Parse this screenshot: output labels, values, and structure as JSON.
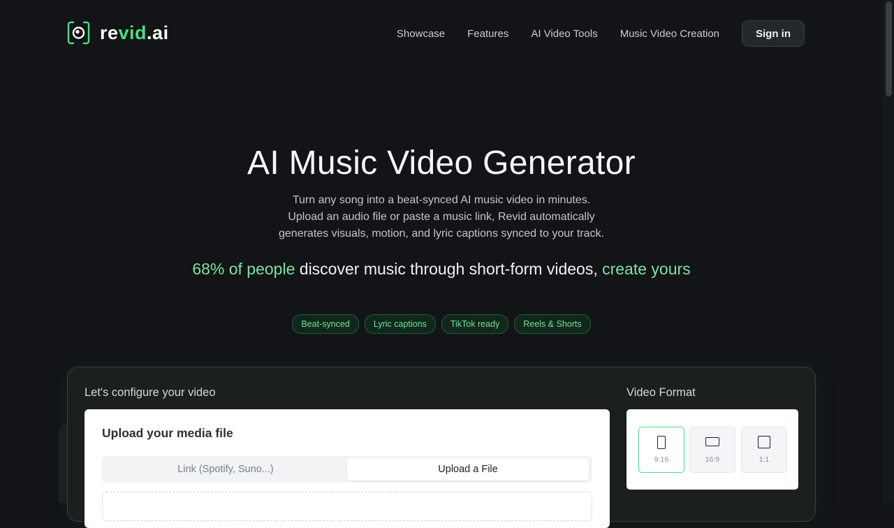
{
  "brand": {
    "name_prefix": "re",
    "name_highlight": "vid",
    "name_suffix": ".ai",
    "accent": "#4ade80"
  },
  "nav": {
    "items": [
      "Showcase",
      "Features",
      "AI Video Tools",
      "Music Video Creation"
    ],
    "signin_label": "Sign in"
  },
  "hero": {
    "title": "AI Music Video Generator",
    "desc_lines": [
      "Turn any song into a beat-synced AI music video in minutes.",
      "Upload an audio file or paste a music link, Revid automatically",
      "generates visuals, motion, and lyric captions synced to your track."
    ],
    "tagline": {
      "highlight1": "68% of people",
      "middle": " discover music through short-form videos, ",
      "highlight2": "create yours"
    },
    "chips": [
      "Beat-synced",
      "Lyric captions",
      "TikTok ready",
      "Reels & Shorts"
    ]
  },
  "config": {
    "title": "Let's configure your video",
    "upload": {
      "title": "Upload your media file",
      "tab_link": "Link (Spotify, Suno...)",
      "tab_upload": "Upload a File",
      "active_tab": "upload"
    },
    "format": {
      "title": "Video Format",
      "options": [
        {
          "label": "9:16",
          "icon": "portrait-icon"
        },
        {
          "label": "16:9",
          "icon": "landscape-icon"
        },
        {
          "label": "1:1",
          "icon": "square-icon"
        }
      ],
      "selected": "9:16"
    }
  }
}
